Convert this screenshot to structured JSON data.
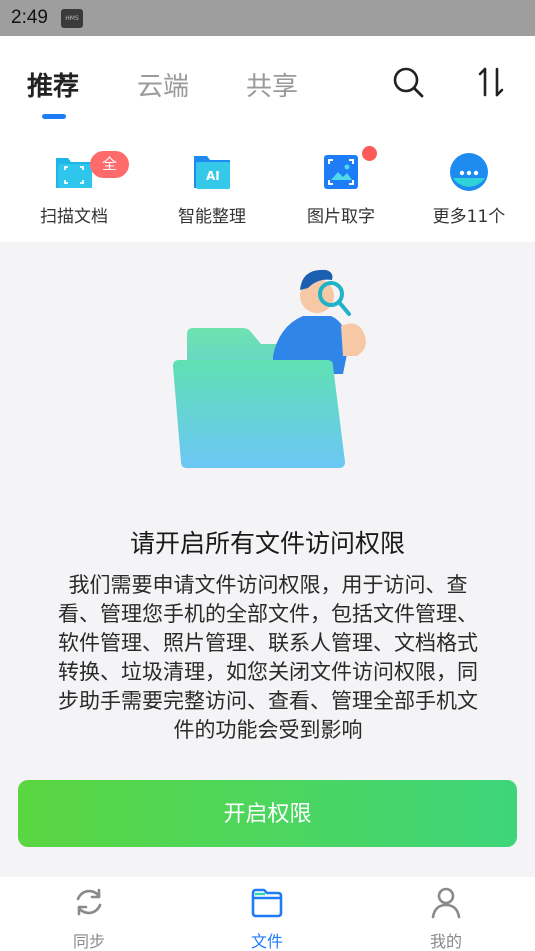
{
  "status_bar": {
    "time": "2:49",
    "hms_label": "HMS"
  },
  "tabs": [
    {
      "label": "推荐",
      "active": true
    },
    {
      "label": "云端",
      "active": false
    },
    {
      "label": "共享",
      "active": false
    }
  ],
  "header_icons": [
    "search-icon",
    "sort-icon"
  ],
  "tools": [
    {
      "label": "扫描文档",
      "icon": "scan-document-icon",
      "badge": "全新"
    },
    {
      "label": "智能整理",
      "icon": "ai-folder-icon"
    },
    {
      "label": "图片取字",
      "icon": "image-text-icon",
      "dot": true
    },
    {
      "label": "更多11个",
      "icon": "more-icon"
    }
  ],
  "permission": {
    "title": "请开启所有文件访问权限",
    "description": "我们需要申请文件访问权限，用于访问、查看、管理您手机的全部文件，包括文件管理、软件管理、照片管理、联系人管理、文档格式转换、垃圾清理，如您关闭文件访问权限，同步助手需要完整访问、查看、管理全部手机文件的功能会受到影响",
    "button": "开启权限"
  },
  "bottom_nav": [
    {
      "label": "同步",
      "icon": "sync-icon",
      "active": false
    },
    {
      "label": "文件",
      "icon": "folder-icon",
      "active": true
    },
    {
      "label": "我的",
      "icon": "profile-icon",
      "active": false
    }
  ],
  "colors": {
    "accent": "#1e7cf6",
    "button_start": "#5bd641",
    "button_end": "#3ed57a",
    "badge": "#ff6a6a"
  }
}
